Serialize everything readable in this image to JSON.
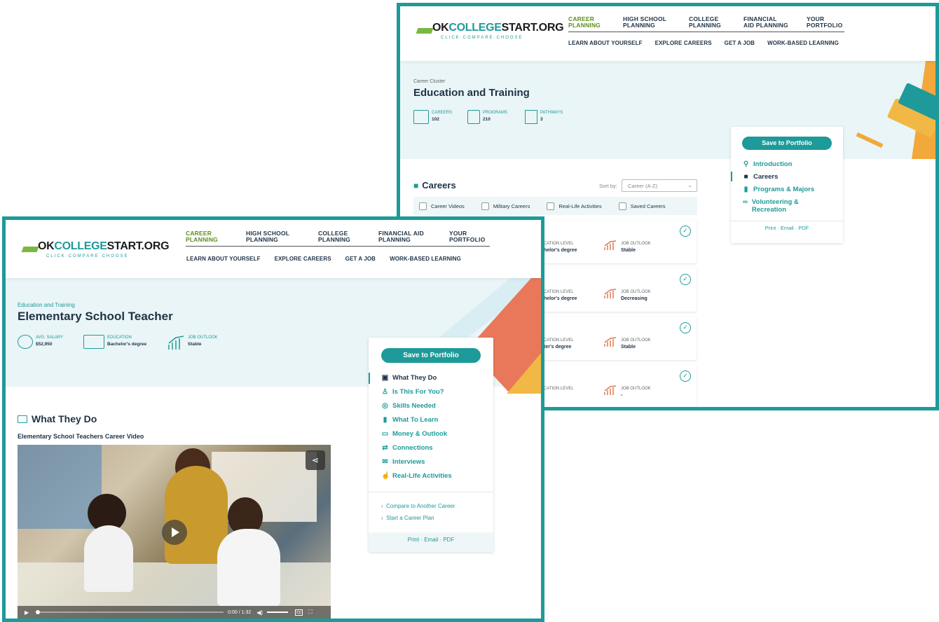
{
  "logo": {
    "ok": "OK",
    "college": "COLLEGE",
    "start": "START.ORG",
    "tagline": "CLICK·COMPARE·CHOOSE"
  },
  "nav": {
    "top": [
      "CAREER PLANNING",
      "HIGH SCHOOL PLANNING",
      "COLLEGE PLANNING",
      "FINANCIAL AID PLANNING",
      "YOUR PORTFOLIO"
    ],
    "sub": [
      "LEARN ABOUT YOURSELF",
      "EXPLORE CAREERS",
      "GET A JOB",
      "WORK-BASED LEARNING"
    ]
  },
  "cluster_page": {
    "eyebrow": "Career Cluster",
    "title": "Education and Training",
    "stats": [
      {
        "label": "CAREERS",
        "value": "102",
        "icon": "briefcase-icon"
      },
      {
        "label": "PROGRAMS",
        "value": "210",
        "icon": "document-icon"
      },
      {
        "label": "PATHWAYS",
        "value": "3",
        "icon": "signpost-icon"
      }
    ],
    "careers_heading": "Careers",
    "sort_label": "Sort by:",
    "sort_value": "Career (A-Z)",
    "filters": [
      "Career Videos",
      "Military Careers",
      "Real-Life Activities",
      "Saved Careers"
    ],
    "rows": [
      {
        "edu_label": "CATION LEVEL",
        "edu_value": "helor's degree",
        "outlook_label": "JOB OUTLOOK",
        "outlook_value": "Stable"
      },
      {
        "edu_label": "CATION LEVEL",
        "edu_value": "helor's degree",
        "outlook_label": "JOB OUTLOOK",
        "outlook_value": "Decreasing"
      },
      {
        "edu_label": "CATION LEVEL",
        "edu_value": "ter's degree",
        "outlook_label": "JOB OUTLOOK",
        "outlook_value": "Stable"
      },
      {
        "edu_label": "CATION LEVEL",
        "edu_value": "",
        "outlook_label": "JOB OUTLOOK",
        "outlook_value": "-"
      }
    ],
    "sidecard": {
      "save": "Save to Portfolio",
      "links": [
        "Introduction",
        "Careers",
        "Programs & Majors",
        "Volunteering & Recreation"
      ],
      "share": "Print · Email · PDF"
    }
  },
  "career_page": {
    "eyebrow": "Education and Training",
    "title": "Elementary School Teacher",
    "stats": [
      {
        "label": "AVG. SALARY",
        "value": "$52,950",
        "icon": "money-icon"
      },
      {
        "label": "EDUCATION",
        "value": "Bachelor's degree",
        "icon": "school-icon"
      },
      {
        "label": "JOB OUTLOOK",
        "value": "Stable",
        "icon": "chart-icon"
      }
    ],
    "section_heading": "What They Do",
    "video_title": "Elementary School Teachers Career Video",
    "video_time": "0:00 / 1:32",
    "sidecard": {
      "save": "Save to Portfolio",
      "links": [
        "What They Do",
        "Is This For You?",
        "Skills Needed",
        "What To Learn",
        "Money & Outlook",
        "Connections",
        "Interviews",
        "Real-Life Activities"
      ],
      "extra_links": [
        "Compare to Another Career",
        "Start a Career Plan"
      ],
      "share": "Print · Email · PDF"
    }
  }
}
